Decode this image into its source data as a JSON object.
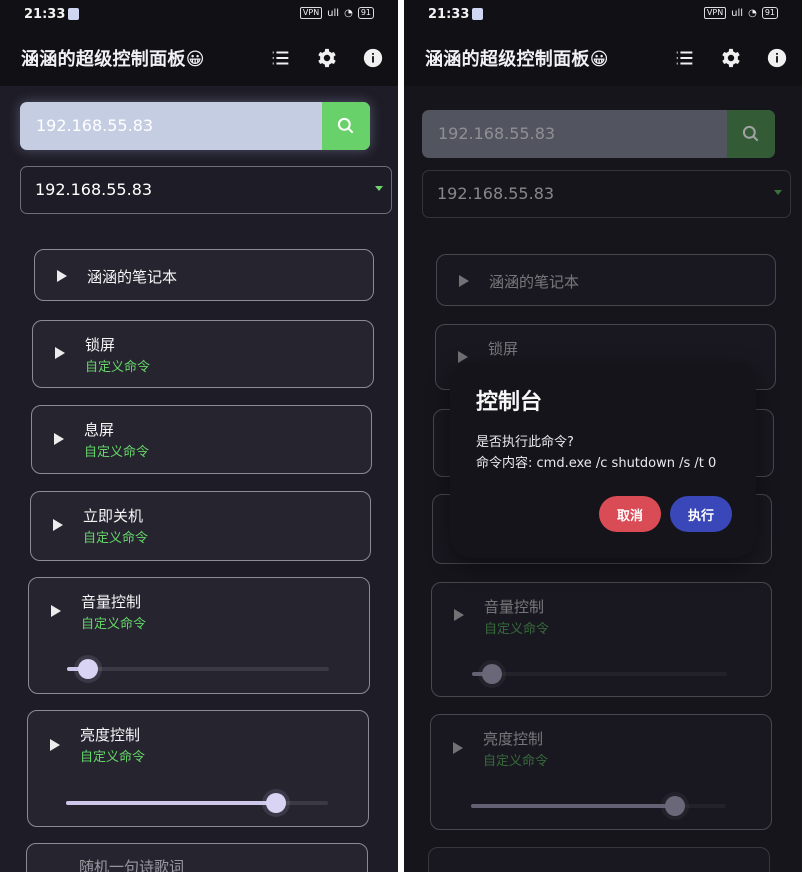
{
  "left": {
    "status": {
      "time": "21:33",
      "vpn": "VPN",
      "signal": "ull",
      "battery": "91"
    },
    "app": {
      "title": "涵涵的超级控制面板😀"
    },
    "search": {
      "value": "192.168.55.83"
    },
    "select": {
      "value": "192.168.55.83"
    },
    "cards": [
      {
        "title": "涵涵的笔记本",
        "subtitle": ""
      },
      {
        "title": "锁屏",
        "subtitle": "自定义命令"
      },
      {
        "title": "息屏",
        "subtitle": "自定义命令"
      },
      {
        "title": "立即关机",
        "subtitle": "自定义命令"
      },
      {
        "title": "音量控制",
        "subtitle": "自定义命令",
        "slider": 0.08
      },
      {
        "title": "亮度控制",
        "subtitle": "自定义命令",
        "slider": 0.8
      },
      {
        "title": "随机一句诗歌词",
        "subtitle": ""
      }
    ]
  },
  "right": {
    "status": {
      "time": "21:33",
      "vpn": "VPN",
      "signal": "ull",
      "battery": "91"
    },
    "app": {
      "title": "涵涵的超级控制面板😀"
    },
    "search": {
      "value": "192.168.55.83"
    },
    "select": {
      "value": "192.168.55.83"
    },
    "cards": [
      {
        "title": "涵涵的笔记本",
        "subtitle": ""
      },
      {
        "title": "锁屏",
        "subtitle": ""
      },
      {
        "title": "音量控制",
        "subtitle": "自定义命令",
        "slider": 0.08
      },
      {
        "title": "亮度控制",
        "subtitle": "自定义命令",
        "slider": 0.8
      }
    ],
    "dialog": {
      "title": "控制台",
      "line1": "是否执行此命令?",
      "line2": "命令内容: cmd.exe /c shutdown /s /t 0",
      "cancel": "取消",
      "confirm": "执行"
    }
  },
  "theme": {
    "green": "#66d66a",
    "cancel": "#d94b55",
    "confirm": "#3947b8"
  }
}
